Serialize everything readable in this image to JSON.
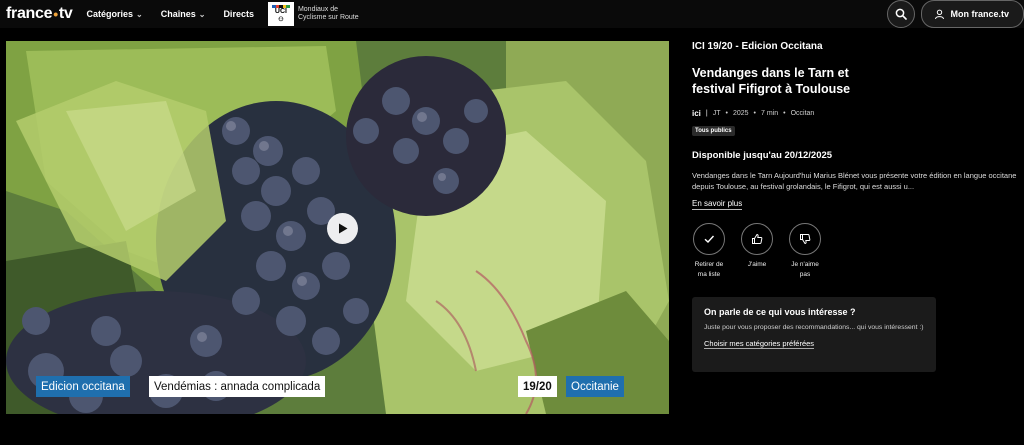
{
  "header": {
    "logo": {
      "word1": "france",
      "word2": "tv"
    },
    "nav": [
      {
        "label": "Catégories",
        "dropdown": true
      },
      {
        "label": "Chaînes",
        "dropdown": true
      },
      {
        "label": "Directs",
        "dropdown": false
      }
    ],
    "uci": {
      "badge": "UCI",
      "line1": "Mondiaux de",
      "line2": "Cyclisme sur Route"
    },
    "account_label": "Mon france.tv"
  },
  "player": {
    "overlay": {
      "left_blue": "Edicion occitana",
      "left_white": "Vendémias : annada complicada",
      "right_white": "19/20",
      "right_blue": "Occitanie"
    }
  },
  "info": {
    "program": "ICI 19/20 - Edicion Occitana",
    "title": "Vendanges dans le Tarn et festival Fifigrot à Toulouse",
    "meta": {
      "channel": "ici",
      "genre": "JT",
      "year": "2025",
      "duration": "7 min",
      "language": "Occitan"
    },
    "badge": "Tous publics",
    "availability": "Disponible jusqu'au 20/12/2025",
    "description": "Vendanges dans le Tarn Aujourd'hui Marius Blénet vous présente votre édition en langue occitane depuis Toulouse, au festival grolandais, le Fifigrot, qui est aussi u...",
    "more_label": "En savoir plus",
    "actions": [
      {
        "icon": "check-icon",
        "label": "Retirer de\nma liste"
      },
      {
        "icon": "thumbs-up-icon",
        "label": "J'aime"
      },
      {
        "icon": "thumbs-down-icon",
        "label": "Je n'aime\npas"
      }
    ],
    "card": {
      "title": "On parle de ce qui vous intéresse ?",
      "text": "Juste pour vous proposer des recommandations... qui vous intéressent :)",
      "link": "Choisir mes catégories préférées"
    }
  }
}
